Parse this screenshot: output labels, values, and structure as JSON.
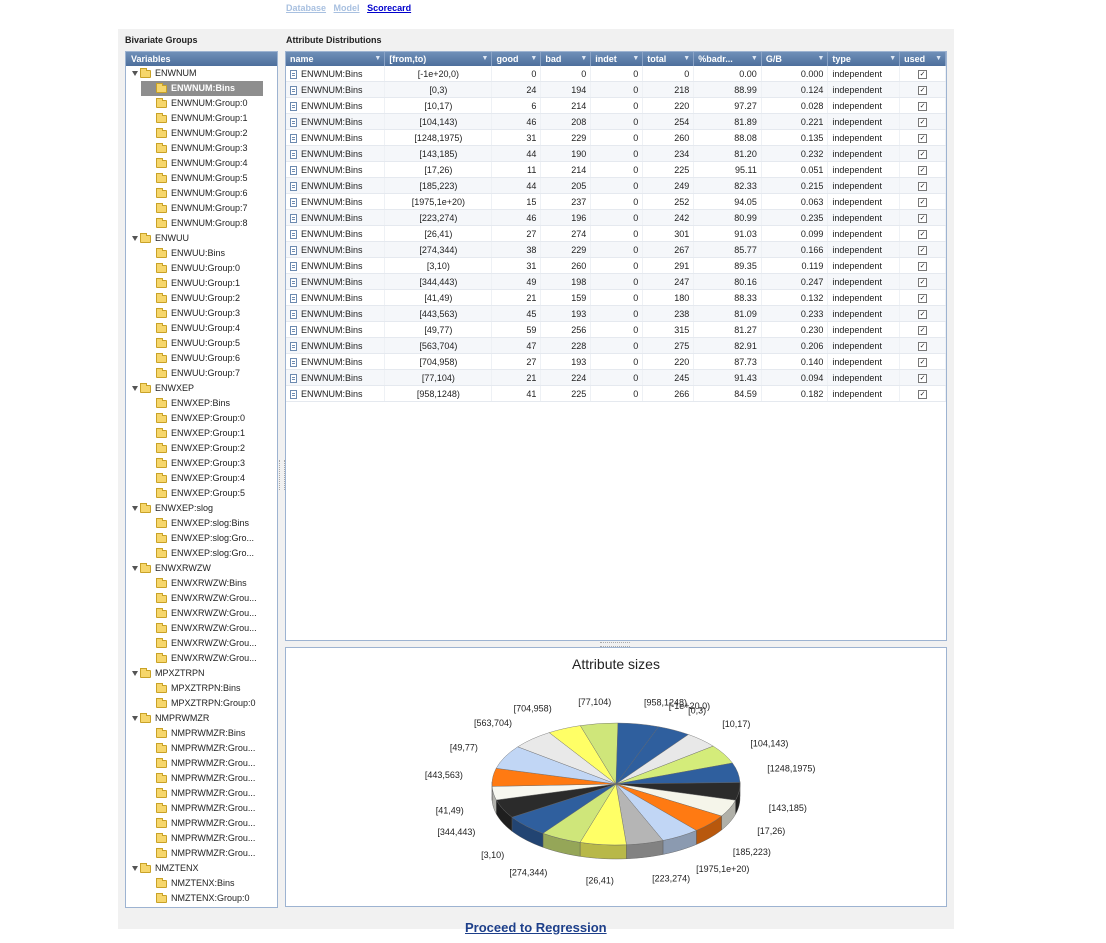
{
  "nav": {
    "links": [
      "Database",
      "Model",
      "Scorecard"
    ],
    "active": "Scorecard"
  },
  "left_panel_title": "Bivariate Groups",
  "right_panel_title": "Attribute Distributions",
  "variables_header": "Variables",
  "tree": [
    {
      "label": "ENWNUM",
      "children": [
        "ENWNUM:Bins",
        "ENWNUM:Group:0",
        "ENWNUM:Group:1",
        "ENWNUM:Group:2",
        "ENWNUM:Group:3",
        "ENWNUM:Group:4",
        "ENWNUM:Group:5",
        "ENWNUM:Group:6",
        "ENWNUM:Group:7",
        "ENWNUM:Group:8"
      ],
      "selected": "ENWNUM:Bins"
    },
    {
      "label": "ENWUU",
      "children": [
        "ENWUU:Bins",
        "ENWUU:Group:0",
        "ENWUU:Group:1",
        "ENWUU:Group:2",
        "ENWUU:Group:3",
        "ENWUU:Group:4",
        "ENWUU:Group:5",
        "ENWUU:Group:6",
        "ENWUU:Group:7"
      ]
    },
    {
      "label": "ENWXEP",
      "children": [
        "ENWXEP:Bins",
        "ENWXEP:Group:0",
        "ENWXEP:Group:1",
        "ENWXEP:Group:2",
        "ENWXEP:Group:3",
        "ENWXEP:Group:4",
        "ENWXEP:Group:5"
      ]
    },
    {
      "label": "ENWXEP:slog",
      "children": [
        "ENWXEP:slog:Bins",
        "ENWXEP:slog:Gro...",
        "ENWXEP:slog:Gro..."
      ]
    },
    {
      "label": "ENWXRWZW",
      "children": [
        "ENWXRWZW:Bins",
        "ENWXRWZW:Grou...",
        "ENWXRWZW:Grou...",
        "ENWXRWZW:Grou...",
        "ENWXRWZW:Grou...",
        "ENWXRWZW:Grou..."
      ]
    },
    {
      "label": "MPXZTRPN",
      "children": [
        "MPXZTRPN:Bins",
        "MPXZTRPN:Group:0"
      ]
    },
    {
      "label": "NMPRWMZR",
      "children": [
        "NMPRWMZR:Bins",
        "NMPRWMZR:Grou...",
        "NMPRWMZR:Grou...",
        "NMPRWMZR:Grou...",
        "NMPRWMZR:Grou...",
        "NMPRWMZR:Grou...",
        "NMPRWMZR:Grou...",
        "NMPRWMZR:Grou...",
        "NMPRWMZR:Grou..."
      ]
    },
    {
      "label": "NMZTENX",
      "children": [
        "NMZTENX:Bins",
        "NMZTENX:Group:0"
      ]
    }
  ],
  "grid": {
    "columns": [
      "name",
      "[from,to)",
      "good",
      "bad",
      "indet",
      "total",
      "%badr...",
      "G/B",
      "type",
      "used"
    ],
    "rows": [
      [
        "ENWNUM:Bins",
        "[-1e+20,0)",
        "0",
        "0",
        "0",
        "0",
        "0.00",
        "0.000",
        "independent",
        true
      ],
      [
        "ENWNUM:Bins",
        "[0,3)",
        "24",
        "194",
        "0",
        "218",
        "88.99",
        "0.124",
        "independent",
        true
      ],
      [
        "ENWNUM:Bins",
        "[10,17)",
        "6",
        "214",
        "0",
        "220",
        "97.27",
        "0.028",
        "independent",
        true
      ],
      [
        "ENWNUM:Bins",
        "[104,143)",
        "46",
        "208",
        "0",
        "254",
        "81.89",
        "0.221",
        "independent",
        true
      ],
      [
        "ENWNUM:Bins",
        "[1248,1975)",
        "31",
        "229",
        "0",
        "260",
        "88.08",
        "0.135",
        "independent",
        true
      ],
      [
        "ENWNUM:Bins",
        "[143,185)",
        "44",
        "190",
        "0",
        "234",
        "81.20",
        "0.232",
        "independent",
        true
      ],
      [
        "ENWNUM:Bins",
        "[17,26)",
        "11",
        "214",
        "0",
        "225",
        "95.11",
        "0.051",
        "independent",
        true
      ],
      [
        "ENWNUM:Bins",
        "[185,223)",
        "44",
        "205",
        "0",
        "249",
        "82.33",
        "0.215",
        "independent",
        true
      ],
      [
        "ENWNUM:Bins",
        "[1975,1e+20)",
        "15",
        "237",
        "0",
        "252",
        "94.05",
        "0.063",
        "independent",
        true
      ],
      [
        "ENWNUM:Bins",
        "[223,274)",
        "46",
        "196",
        "0",
        "242",
        "80.99",
        "0.235",
        "independent",
        true
      ],
      [
        "ENWNUM:Bins",
        "[26,41)",
        "27",
        "274",
        "0",
        "301",
        "91.03",
        "0.099",
        "independent",
        true
      ],
      [
        "ENWNUM:Bins",
        "[274,344)",
        "38",
        "229",
        "0",
        "267",
        "85.77",
        "0.166",
        "independent",
        true
      ],
      [
        "ENWNUM:Bins",
        "[3,10)",
        "31",
        "260",
        "0",
        "291",
        "89.35",
        "0.119",
        "independent",
        true
      ],
      [
        "ENWNUM:Bins",
        "[344,443)",
        "49",
        "198",
        "0",
        "247",
        "80.16",
        "0.247",
        "independent",
        true
      ],
      [
        "ENWNUM:Bins",
        "[41,49)",
        "21",
        "159",
        "0",
        "180",
        "88.33",
        "0.132",
        "independent",
        true
      ],
      [
        "ENWNUM:Bins",
        "[443,563)",
        "45",
        "193",
        "0",
        "238",
        "81.09",
        "0.233",
        "independent",
        true
      ],
      [
        "ENWNUM:Bins",
        "[49,77)",
        "59",
        "256",
        "0",
        "315",
        "81.27",
        "0.230",
        "independent",
        true
      ],
      [
        "ENWNUM:Bins",
        "[563,704)",
        "47",
        "228",
        "0",
        "275",
        "82.91",
        "0.206",
        "independent",
        true
      ],
      [
        "ENWNUM:Bins",
        "[704,958)",
        "27",
        "193",
        "0",
        "220",
        "87.73",
        "0.140",
        "independent",
        true
      ],
      [
        "ENWNUM:Bins",
        "[77,104)",
        "21",
        "224",
        "0",
        "245",
        "91.43",
        "0.094",
        "independent",
        true
      ],
      [
        "ENWNUM:Bins",
        "[958,1248)",
        "41",
        "225",
        "0",
        "266",
        "84.59",
        "0.182",
        "independent",
        true
      ]
    ]
  },
  "chart_data": {
    "type": "pie",
    "title": "Attribute sizes",
    "slices": [
      {
        "label": "[-1e+20,0)",
        "value": 0
      },
      {
        "label": "[0,3)",
        "value": 218
      },
      {
        "label": "[10,17)",
        "value": 220
      },
      {
        "label": "[104,143)",
        "value": 254
      },
      {
        "label": "[1248,1975)",
        "value": 260
      },
      {
        "label": "[143,185)",
        "value": 234
      },
      {
        "label": "[17,26)",
        "value": 225
      },
      {
        "label": "[185,223)",
        "value": 249
      },
      {
        "label": "[1975,1e+20)",
        "value": 252
      },
      {
        "label": "[223,274)",
        "value": 242
      },
      {
        "label": "[26,41)",
        "value": 301
      },
      {
        "label": "[274,344)",
        "value": 267
      },
      {
        "label": "[3,10)",
        "value": 291
      },
      {
        "label": "[344,443)",
        "value": 247
      },
      {
        "label": "[41,49)",
        "value": 180
      },
      {
        "label": "[443,563)",
        "value": 238
      },
      {
        "label": "[49,77)",
        "value": 315
      },
      {
        "label": "[563,704)",
        "value": 275
      },
      {
        "label": "[704,958)",
        "value": 220
      },
      {
        "label": "[77,104)",
        "value": 245
      },
      {
        "label": "[958,1248)",
        "value": 266
      }
    ],
    "colors": [
      "#f2f2f2",
      "#2f5f9e",
      "#e8e8e8",
      "#d4ec7a",
      "#2f5f9e",
      "#2b2b2b",
      "#f5f5ea",
      "#ff7a12",
      "#c1d6f5",
      "#b5b5b5",
      "#ffff66",
      "#cfe67a",
      "#2f5f9e",
      "#2b2b2b",
      "#f7f7f0",
      "#ff7a12",
      "#c1d6f5",
      "#e9e9e9",
      "#ffff66",
      "#cfe67a",
      "#2f5f9e"
    ]
  },
  "proceed_label": "Proceed to Regression"
}
